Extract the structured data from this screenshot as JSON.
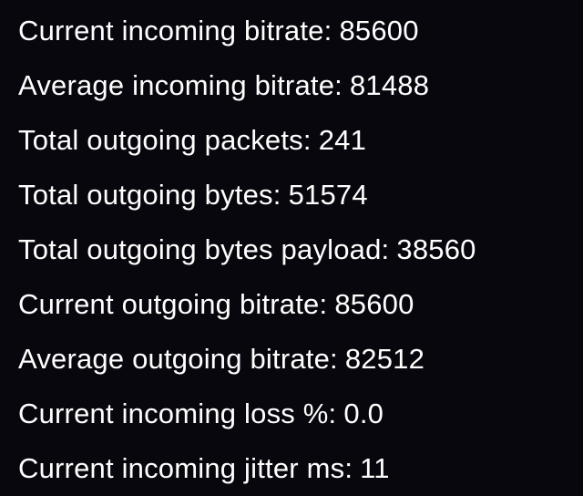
{
  "stats": [
    {
      "label": "Current incoming bitrate:",
      "value": "85600"
    },
    {
      "label": "Average incoming bitrate:",
      "value": "81488"
    },
    {
      "label": "Total outgoing packets:",
      "value": "241"
    },
    {
      "label": "Total outgoing bytes:",
      "value": "51574"
    },
    {
      "label": "Total outgoing bytes payload:",
      "value": "38560"
    },
    {
      "label": "Current outgoing bitrate:",
      "value": "85600"
    },
    {
      "label": "Average outgoing bitrate:",
      "value": "82512"
    },
    {
      "label": "Current incoming loss %:",
      "value": "0.0"
    },
    {
      "label": "Current incoming jitter ms:",
      "value": "11"
    }
  ]
}
